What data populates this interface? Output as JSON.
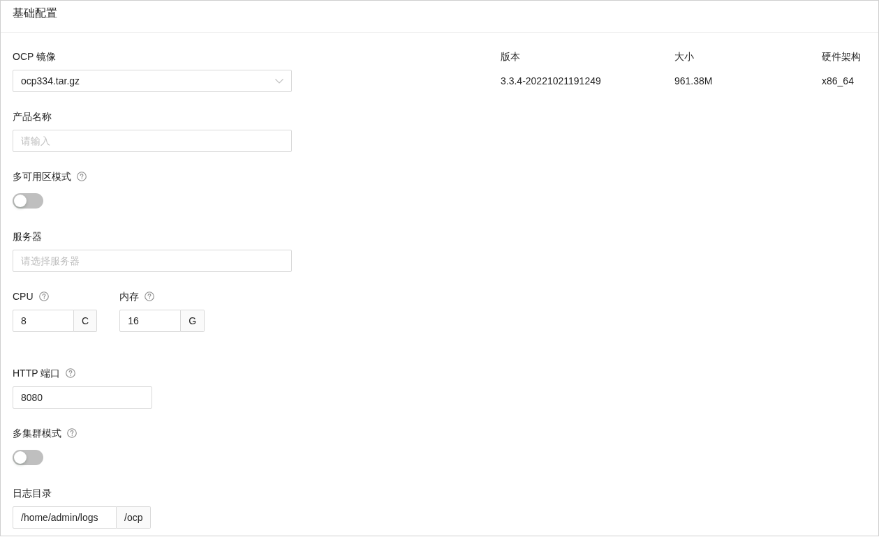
{
  "section": {
    "title": "基础配置"
  },
  "image": {
    "label": "OCP 镜像",
    "value": "ocp334.tar.gz"
  },
  "image_info": [
    {
      "label": "版本",
      "value": "3.3.4-20221021191249"
    },
    {
      "label": "大小",
      "value": "961.38M"
    },
    {
      "label": "硬件架构",
      "value": "x86_64"
    }
  ],
  "fields": [
    {
      "kind": "input",
      "label": "产品名称",
      "placeholder": "请输入"
    },
    {
      "kind": "switch",
      "label": "多可用区模式",
      "help": true,
      "on": false
    },
    {
      "kind": "input",
      "label": "服务器",
      "placeholder": "请选择服务器"
    },
    {
      "kind": "resources",
      "items": [
        {
          "label": "CPU",
          "help": true,
          "value": "8",
          "suffix": "C"
        },
        {
          "label": "内存",
          "help": true,
          "value": "16",
          "suffix": "G"
        }
      ]
    },
    {
      "kind": "number",
      "label": "HTTP 端口",
      "help": true,
      "value": "8080"
    },
    {
      "kind": "switch",
      "label": "多集群模式",
      "help": true,
      "on": false
    },
    {
      "kind": "path",
      "label": "日志目录",
      "value": "/home/admin/logs",
      "suffix": "/ocp"
    }
  ]
}
